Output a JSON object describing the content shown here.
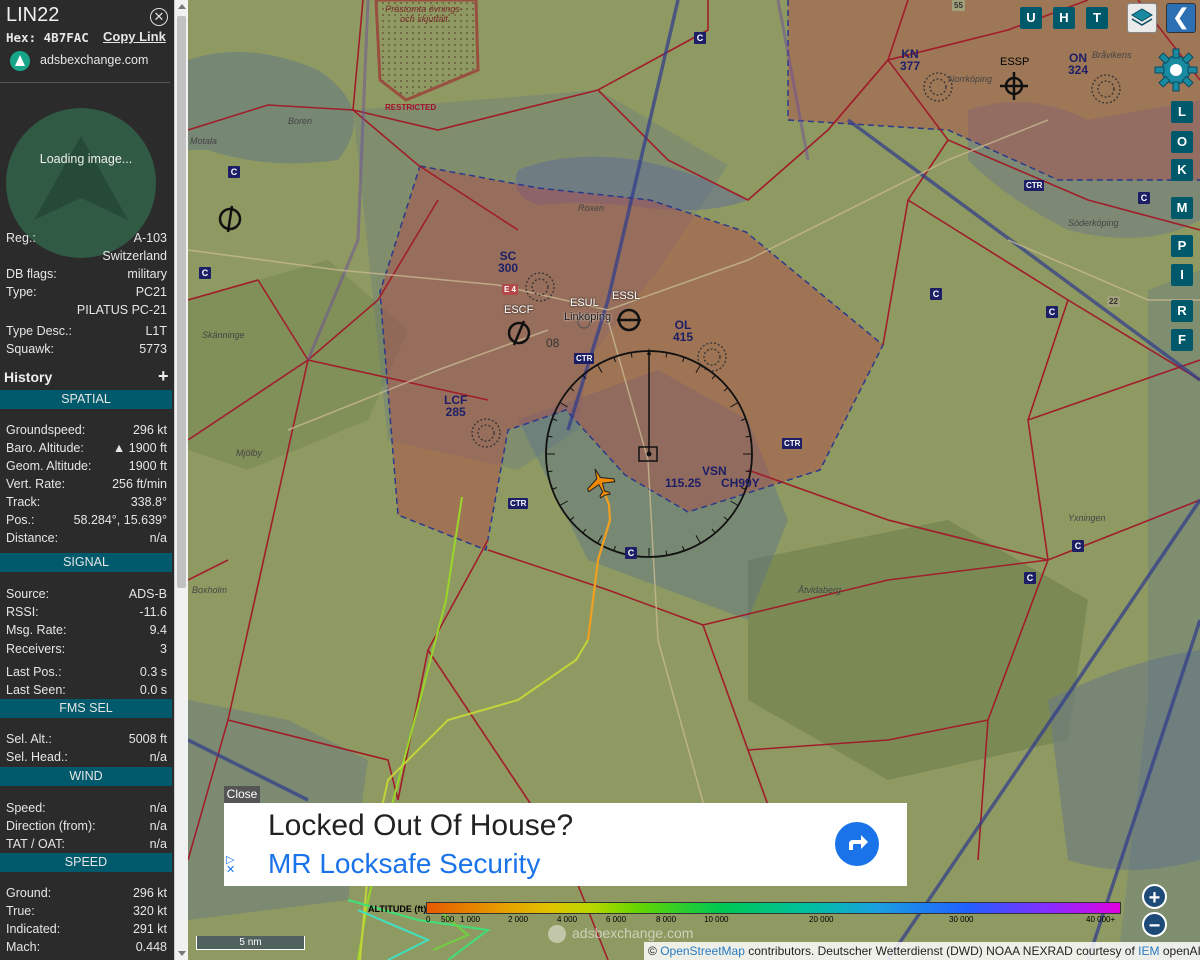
{
  "aircraft": {
    "callsign": "LIN22",
    "hex_label": "Hex:",
    "hex": "4B7FAC",
    "copy_link": "Copy Link",
    "site": "adsbexchange.com",
    "photo_status": "Loading image..."
  },
  "details": [
    {
      "k": "Reg.:",
      "v": "A-103"
    },
    {
      "k": "",
      "v": "Switzerland"
    },
    {
      "k": "DB flags:",
      "v": "military"
    },
    {
      "k": "Type:",
      "v": "PC21"
    },
    {
      "k": "",
      "v": "PILATUS PC-21"
    },
    {
      "k": "Type Desc.:",
      "v": "L1T"
    },
    {
      "k": "Squawk:",
      "v": "5773"
    }
  ],
  "history": {
    "label": "History",
    "toggle": "+"
  },
  "sections": {
    "spatial": {
      "title": "SPATIAL",
      "rows": [
        {
          "k": "Groundspeed:",
          "v": "296 kt"
        },
        {
          "k": "Baro. Altitude:",
          "v": "▲ 1900 ft"
        },
        {
          "k": "Geom. Altitude:",
          "v": "1900 ft"
        },
        {
          "k": "Vert. Rate:",
          "v": "256 ft/min"
        },
        {
          "k": "Track:",
          "v": "338.8°"
        },
        {
          "k": "Pos.:",
          "v": "58.284°, 15.639°"
        },
        {
          "k": "Distance:",
          "v": "n/a"
        }
      ]
    },
    "signal": {
      "title": "SIGNAL",
      "rows": [
        {
          "k": "Source:",
          "v": "ADS-B"
        },
        {
          "k": "RSSI:",
          "v": "-11.6"
        },
        {
          "k": "Msg. Rate:",
          "v": "9.4"
        },
        {
          "k": "Receivers:",
          "v": "3"
        },
        {
          "k": "Last Pos.:",
          "v": "0.3 s"
        },
        {
          "k": "Last Seen:",
          "v": "0.0 s"
        }
      ]
    },
    "fms": {
      "title": "FMS SEL",
      "rows": [
        {
          "k": "Sel. Alt.:",
          "v": "5008 ft"
        },
        {
          "k": "Sel. Head.:",
          "v": "n/a"
        }
      ]
    },
    "wind": {
      "title": "WIND",
      "rows": [
        {
          "k": "Speed:",
          "v": "n/a"
        },
        {
          "k": "Direction (from):",
          "v": "n/a"
        },
        {
          "k": "TAT / OAT:",
          "v": "n/a"
        }
      ]
    },
    "speed": {
      "title": "SPEED",
      "rows": [
        {
          "k": "Ground:",
          "v": "296 kt"
        },
        {
          "k": "True:",
          "v": "320 kt"
        },
        {
          "k": "Indicated:",
          "v": "291 kt"
        },
        {
          "k": "Mach:",
          "v": "0.448"
        }
      ]
    }
  },
  "map_buttons": {
    "top": [
      "U",
      "H",
      "T"
    ],
    "side": [
      "L",
      "O",
      "K",
      "M",
      "P",
      "I",
      "R",
      "F"
    ],
    "back": "❮",
    "zoom_in": "+",
    "zoom_out": "−"
  },
  "map_labels": {
    "kn": "KN",
    "kn_alt": "377",
    "essp": "ESSP",
    "on": "ON",
    "on_alt": "324",
    "sc": "SC",
    "sc_alt": "300",
    "escf": "ESCF",
    "esul": "ESUL",
    "essl": "ESSL",
    "linkoping": "Linköping",
    "ol": "OL",
    "ol_alt": "415",
    "lcf": "LCF",
    "lcf_alt": "285",
    "vsn": "VSN",
    "vsn_freq": "115.25",
    "vsn_id": "CH99Y",
    "d08": "08",
    "restricted": "RESTRICTED",
    "prastomta": "Prästomta övnings- och skjutfält",
    "roxen": "Roxen",
    "soderkoping": "Söderköping",
    "mjolby": "Mjölby",
    "skanninge": "Skänninge",
    "atvidaberg": "Åtvidaberg",
    "yxningen": "Yxningen",
    "boxholm": "Boxholm",
    "boren": "Boren",
    "motala": "Motala",
    "norrkoping": "Norrköping",
    "bravik": "Bråvikens",
    "e4": "E 4",
    "r22": "22",
    "r55": "55",
    "ctr": "CTR",
    "c": "C"
  },
  "ad": {
    "close": "Close",
    "headline": "Locked Out Of House?",
    "advertiser": "MR Locksafe Security",
    "adchoices": "▷\n✕"
  },
  "altitude_legend": {
    "title": "ALTITUDE (ft)",
    "ticks": [
      "0",
      "500",
      "1 000",
      "2 000",
      "4 000",
      "6 000",
      "8 000",
      "10 000",
      "20 000",
      "30 000",
      "40 000+"
    ]
  },
  "scale": "5 nm",
  "watermark": "adsbexchange.com",
  "attribution": {
    "prefix": "©",
    "osm": "OpenStreetMap",
    "mid": "contributors. Deutscher Wetterdienst (DWD) NOAA NEXRAD courtesy of",
    "iem": "IEM",
    "suffix": "openAIP.net"
  },
  "colors": {
    "sidebar_bg": "#2b2b2b",
    "section_bg": "#005a6b",
    "map_button": "#00596b",
    "airspace_red": "#b22234",
    "airspace_blue": "#2b3a8a",
    "aircraft_orange": "#f08a00"
  }
}
